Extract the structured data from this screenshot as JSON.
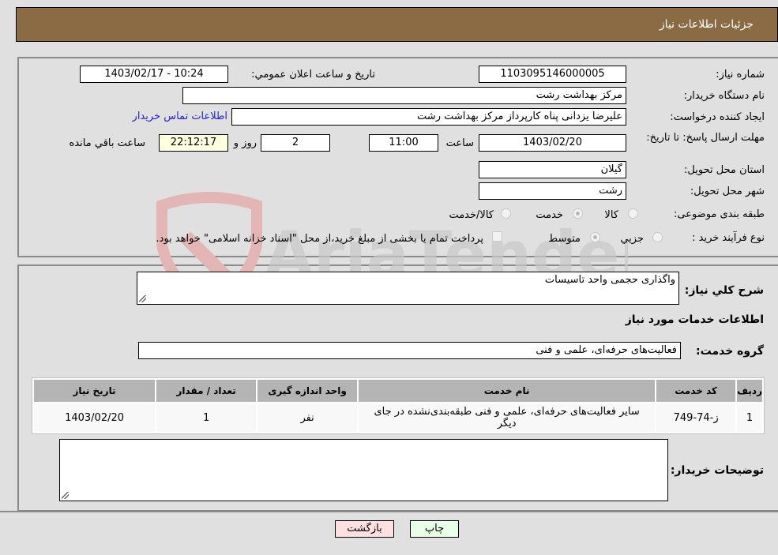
{
  "header": {
    "title": "جزئیات اطلاعات نیاز"
  },
  "fields": {
    "need_number_label": "شماره نیاز:",
    "need_number": "1103095146000005",
    "announce_label": "تاریخ و ساعت اعلان عمومي:",
    "announce_value": "1403/02/17 - 10:24",
    "buyer_org_label": "نام دستگاه خریدار:",
    "buyer_org": "مرکز بهداشت رشت",
    "creator_label": "ایجاد کننده درخواست:",
    "creator": "علیرضا یزدانی پناه کارپرداز مرکز بهداشت رشت",
    "contact_link": "اطلاعات تماس خریدار",
    "deadline_label": "مهلت ارسال پاسخ: تا تاریخ:",
    "deadline_date": "1403/02/20",
    "time_label": "ساعت",
    "deadline_time": "11:00",
    "days_value": "2",
    "days_label": "روز و",
    "remaining_time": "22:12:17",
    "remaining_label": "ساعت باقي مانده",
    "province_label": "استان محل تحویل:",
    "province": "گیلان",
    "city_label": "شهر محل تحویل:",
    "city": "رشت",
    "category_label": "طبقه بندی موضوعی:",
    "category_options": [
      "کالا",
      "خدمت",
      "کالا/خدمت"
    ],
    "category_selected": "خدمت",
    "purchase_type_label": "نوع فرآیند خرید :",
    "purchase_type_options": [
      "جزيي",
      "متوسط"
    ],
    "purchase_type_selected": "متوسط",
    "treasury_note": "پرداخت تمام یا بخشی از مبلغ خرید،از محل \"اسناد خزانه اسلامی\" خواهد بود."
  },
  "details": {
    "description_label": "شرح کلي نیاز:",
    "description": "واگذاری حجمی واحد تاسیسات",
    "services_heading": "اطلاعات خدمات مورد نیاز",
    "service_group_label": "گروه خدمت:",
    "service_group": "فعالیت‌های حرفه‌ای، علمی و فنی",
    "buyer_notes_label": "توضیحات خریدار:",
    "buyer_notes": ""
  },
  "table": {
    "headers": [
      "ردیف",
      "کد خدمت",
      "نام خدمت",
      "واحد اندازه گیری",
      "تعداد / مقدار",
      "تاریخ نیاز"
    ],
    "rows": [
      [
        "1",
        "ز-74-749",
        "سایر فعالیت‌های حرفه‌ای، علمی و فنی طبقه‌بندی‌نشده در جای دیگر",
        "نفر",
        "1",
        "1403/02/20"
      ]
    ]
  },
  "buttons": {
    "print": "چاپ",
    "back": "بازگشت"
  },
  "watermark": {
    "text": "AriaTender.neT"
  }
}
